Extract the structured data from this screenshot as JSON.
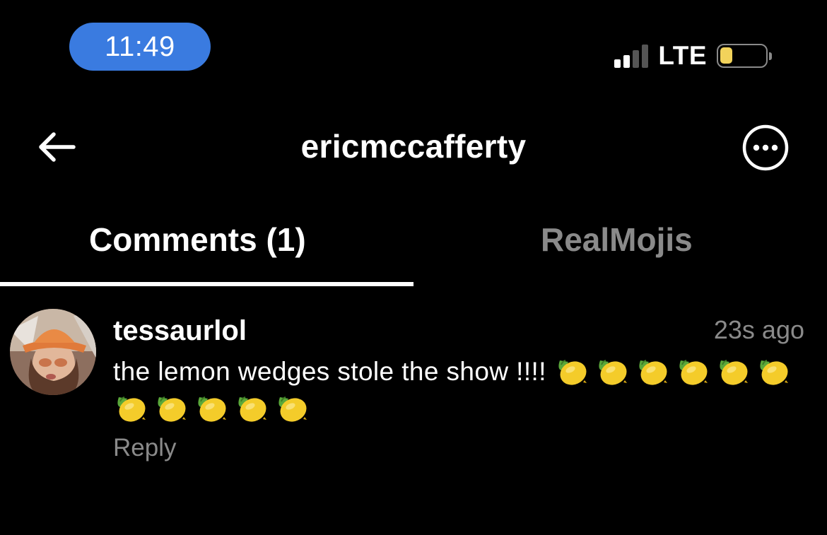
{
  "status_bar": {
    "time": "11:49",
    "network": "LTE",
    "signal_bars_active": 2,
    "battery_level": 0.2,
    "time_pill_color": "#3A7BE0",
    "battery_fill_color": "#F2D35B"
  },
  "header": {
    "title": "ericmccafferty",
    "back_icon": "arrow-left-icon",
    "more_icon": "more-circle-icon"
  },
  "tabs": [
    {
      "label": "Comments (1)",
      "active": true
    },
    {
      "label": "RealMojis",
      "active": false
    }
  ],
  "comments": [
    {
      "username": "tessaurlol",
      "timestamp": "23s ago",
      "text": "the lemon wedges stole the show !!!!",
      "emoji": "lemon-icon",
      "emoji_count": 11,
      "reply_label": "Reply"
    }
  ]
}
